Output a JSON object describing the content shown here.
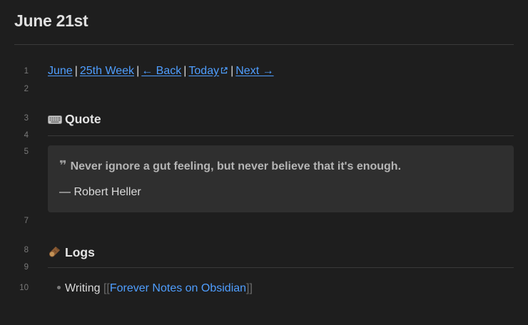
{
  "note": {
    "title": "June 21st"
  },
  "line_numbers": [
    "1",
    "2",
    "3",
    "4",
    "5",
    "7",
    "8",
    "9",
    "10"
  ],
  "nav": {
    "month": "June",
    "week": "25th Week",
    "back": "← Back",
    "today": "Today",
    "next": "Next →",
    "separator": "|"
  },
  "quote_section": {
    "heading": "Quote",
    "icon": "keyboard-icon",
    "quote": "Never ignore a gut feeling, but never believe that it's enough.",
    "author": "— Robert Heller"
  },
  "logs_section": {
    "heading": "Logs",
    "icon": "wood-log-icon",
    "items": [
      {
        "prefix": "Writing",
        "link_open": "[[",
        "link": "Forever Notes on Obsidian",
        "link_close": "]]"
      }
    ]
  },
  "colors": {
    "background": "#1e1e1e",
    "link": "#4f9eff",
    "callout": "#2f2f2f",
    "muted": "#7a7a7a"
  }
}
